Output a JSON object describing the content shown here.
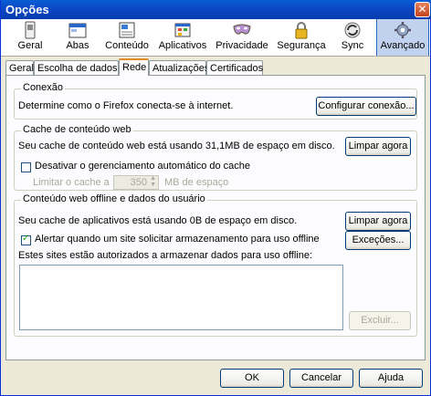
{
  "window": {
    "title": "Opções",
    "close_glyph": "✕"
  },
  "toolbar": {
    "items": [
      {
        "label": "Geral",
        "icon": "general-switch-icon"
      },
      {
        "label": "Abas",
        "icon": "tabs-window-icon"
      },
      {
        "label": "Conteúdo",
        "icon": "content-page-icon"
      },
      {
        "label": "Aplicativos",
        "icon": "applications-icon"
      },
      {
        "label": "Privacidade",
        "icon": "privacy-mask-icon"
      },
      {
        "label": "Segurança",
        "icon": "security-lock-icon"
      },
      {
        "label": "Sync",
        "icon": "sync-icon"
      },
      {
        "label": "Avançado",
        "icon": "advanced-gear-icon"
      }
    ],
    "selected": "Avançado"
  },
  "tabs": {
    "items": [
      "Geral",
      "Escolha de dados",
      "Rede",
      "Atualizações",
      "Certificados"
    ],
    "selected": "Rede"
  },
  "connection": {
    "legend": "Conexão",
    "description": "Determine como o Firefox conecta-se à internet.",
    "button": "Configurar conexão..."
  },
  "cache": {
    "legend": "Cache de conteúdo web",
    "description": "Seu cache de conteúdo web está usando 31,1MB de espaço em disco.",
    "clear_button": "Limpar agora",
    "override_checkbox": "Desativar o gerenciamento automático do cache",
    "override_checked": false,
    "limit_label": "Limitar o cache a",
    "limit_value": "350",
    "limit_unit": "MB de espaço"
  },
  "offline": {
    "legend": "Conteúdo web offline e dados do usuário",
    "description": "Seu cache de aplicativos está usando 0B de espaço em disco.",
    "clear_button": "Limpar agora",
    "warn_checkbox": "Alertar quando um site solicitar armazenamento para uso offline",
    "warn_checked": true,
    "exceptions_button": "Exceções...",
    "list_label": "Estes sites estão autorizados a armazenar dados para uso offline:",
    "remove_button": "Excluir..."
  },
  "footer": {
    "ok": "OK",
    "cancel": "Cancelar",
    "help": "Ajuda"
  },
  "colors": {
    "titlebar": "#0b46c4",
    "selected_tool": "#c1d2ee",
    "tab_highlight": "#e68b2c"
  }
}
